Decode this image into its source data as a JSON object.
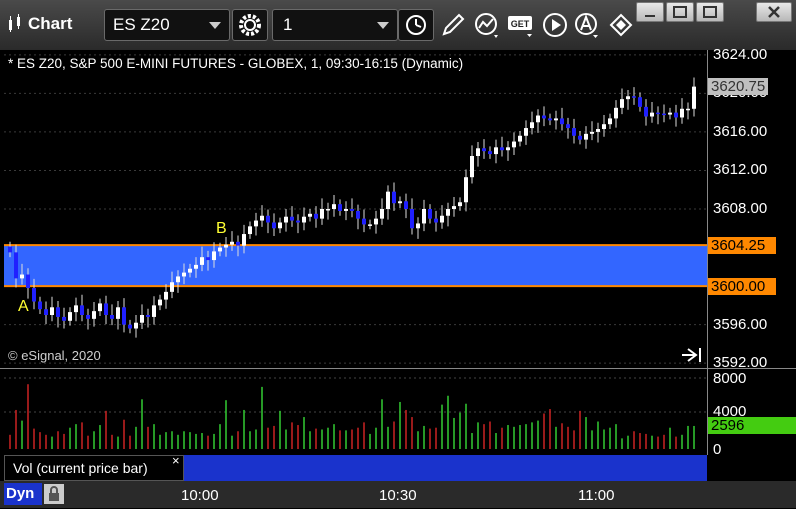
{
  "titlebar": {
    "app_title": "Chart",
    "symbol": "ES Z20",
    "interval": "1"
  },
  "chart": {
    "header": "* ES Z20, S&P 500 E-MINI FUTURES - GLOBEX, 1, 09:30-16:15 (Dynamic)",
    "copyright": "© eSignal, 2020",
    "annotations": {
      "a": "A",
      "b": "B"
    },
    "price_axis": [
      "3624.00",
      "3620.00",
      "3616.00",
      "3612.00",
      "3608.00",
      "3604.00",
      "3600.00",
      "3596.00",
      "3592.00"
    ],
    "price_tags": {
      "last": "3620.75",
      "upper": "3604.25",
      "lower": "3600.00"
    },
    "vol_axis": [
      "8000",
      "4000",
      "0"
    ],
    "vol_tag": "2596",
    "vol_study_label": "Vol (current price bar)",
    "vol_close": "×",
    "time_axis": [
      "10:00",
      "10:30",
      "11:00"
    ],
    "dyn_label": "Dyn",
    "colors": {
      "up_candle": "#ffffff",
      "down_candle": "#2020ff",
      "zone": "#3366ff",
      "zone_border": "#ff8800",
      "vol_up": "#33cc33",
      "vol_down": "#cc2222",
      "vol_tag": "#44cc11",
      "last_tag": "#c0c0c0"
    }
  },
  "chart_data": {
    "type": "candlestick",
    "title": "* ES Z20, S&P 500 E-MINI FUTURES - GLOBEX, 1, 09:30-16:15 (Dynamic)",
    "ylim": [
      3591.5,
      3624.5
    ],
    "y_ticks": [
      3592,
      3596,
      3600,
      3604,
      3608,
      3612,
      3616,
      3620,
      3624
    ],
    "x_ticks": [
      "10:00",
      "10:30",
      "11:00"
    ],
    "zone": [
      3600.0,
      3604.25
    ],
    "last": 3620.75,
    "closes": [
      3603.5,
      3600.8,
      3601.2,
      3599.8,
      3598.4,
      3597.6,
      3597.0,
      3597.8,
      3596.8,
      3596.4,
      3597.3,
      3598.0,
      3597.0,
      3596.6,
      3597.4,
      3598.2,
      3597.0,
      3596.6,
      3597.8,
      3596.0,
      3595.6,
      3596.2,
      3597.0,
      3596.8,
      3598.0,
      3598.6,
      3599.4,
      3600.4,
      3601.0,
      3601.4,
      3601.8,
      3602.2,
      3603.0,
      3602.7,
      3603.6,
      3604.0,
      3604.3,
      3604.6,
      3604.2,
      3605.4,
      3606.2,
      3606.8,
      3607.3,
      3606.6,
      3606.0,
      3606.6,
      3607.2,
      3606.8,
      3606.6,
      3607.2,
      3607.5,
      3607.0,
      3608.0,
      3608.0,
      3608.5,
      3607.8,
      3608.0,
      3607.8,
      3607.0,
      3606.4,
      3606.4,
      3607.0,
      3608.0,
      3609.8,
      3608.6,
      3608.8,
      3608.0,
      3606.0,
      3606.5,
      3608.0,
      3607.0,
      3606.6,
      3607.3,
      3608.0,
      3608.3,
      3608.7,
      3611.3,
      3613.5,
      3614.3,
      3614.0,
      3613.7,
      3614.4,
      3614.1,
      3614.4,
      3615.0,
      3615.6,
      3616.4,
      3617.0,
      3617.7,
      3617.4,
      3617.2,
      3617.4,
      3616.8,
      3616.4,
      3615.6,
      3615.2,
      3615.8,
      3616.0,
      3616.3,
      3616.8,
      3617.4,
      3618.5,
      3619.4,
      3619.7,
      3619.6,
      3618.6,
      3617.6,
      3618.0,
      3617.9,
      3617.8,
      3618.0,
      3617.5,
      3618.4,
      3618.4,
      3620.7
    ],
    "volumes": [
      1600,
      4400,
      3200,
      7300,
      2300,
      1900,
      1600,
      1400,
      2000,
      1700,
      2400,
      2800,
      3000,
      1500,
      2000,
      2700,
      4300,
      1600,
      1400,
      3300,
      1500,
      2500,
      5600,
      2500,
      2800,
      1600,
      1900,
      2000,
      1600,
      2000,
      1900,
      1700,
      1800,
      1500,
      1700,
      2800,
      5500,
      1500,
      2000,
      4400,
      2000,
      2200,
      7000,
      2400,
      2600,
      4300,
      2200,
      3000,
      2700,
      3600,
      2000,
      2300,
      2200,
      2400,
      2800,
      2100,
      2100,
      2200,
      2400,
      3000,
      1700,
      2400,
      5600,
      2500,
      3100,
      5300,
      4400,
      3600,
      2000,
      2600,
      2300,
      2400,
      5000,
      6000,
      3500,
      4100,
      5100,
      1800,
      3000,
      2800,
      3100,
      1800,
      2400,
      2700,
      2500,
      2700,
      2800,
      3000,
      3200,
      4000,
      4500,
      2500,
      2900,
      2500,
      2100,
      4300,
      3600,
      2100,
      3100,
      2200,
      2400,
      2800,
      1200,
      1500,
      2000,
      1800,
      1700,
      1500,
      1400,
      1600,
      2400,
      1400,
      1600,
      2600,
      2596
    ]
  }
}
